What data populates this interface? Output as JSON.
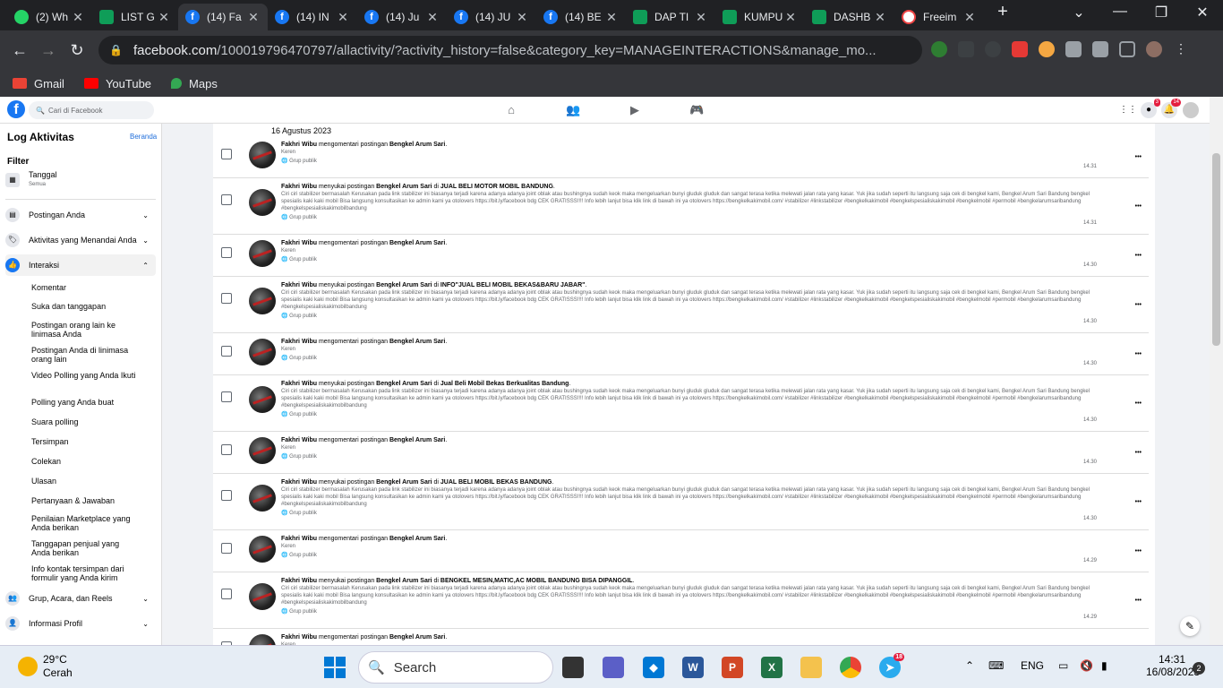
{
  "tabs": [
    {
      "label": "(2) Wh",
      "icon": "whatsapp-icon"
    },
    {
      "label": "LIST G",
      "icon": "sheets-icon"
    },
    {
      "label": "(14) Fa",
      "icon": "facebook-icon",
      "active": true
    },
    {
      "label": "(14) IN",
      "icon": "facebook-icon"
    },
    {
      "label": "(14) Ju",
      "icon": "facebook-icon"
    },
    {
      "label": "(14) JU",
      "icon": "facebook-icon"
    },
    {
      "label": "(14) BE",
      "icon": "facebook-icon"
    },
    {
      "label": "DAP TI",
      "icon": "sheets-icon"
    },
    {
      "label": "KUMPU",
      "icon": "sheets-icon"
    },
    {
      "label": "DASHB",
      "icon": "sheets-icon"
    },
    {
      "label": "Freeim",
      "icon": "freeimage-icon"
    }
  ],
  "browser": {
    "url_main": "facebook.com",
    "url_rest": "/100019796470797/allactivity/?activity_history=false&category_key=MANAGEINTERACTIONS&manage_mo..."
  },
  "bookmarks": [
    {
      "label": "Gmail",
      "color": "#ea4335"
    },
    {
      "label": "YouTube",
      "color": "#ff0000"
    },
    {
      "label": "Maps",
      "color": "#34a853"
    }
  ],
  "fb": {
    "search_placeholder": "Cari di Facebook",
    "badge_msg": "3",
    "badge_notif": "14"
  },
  "sidebar": {
    "title": "Log Aktivitas",
    "home": "Beranda",
    "filter": "Filter",
    "date_label": "Tanggal",
    "date_sub": "Semua",
    "sections": [
      {
        "label": "Postingan Anda"
      },
      {
        "label": "Aktivitas yang Menandai Anda"
      },
      {
        "label": "Interaksi"
      }
    ],
    "subitems": [
      "Komentar",
      "Suka dan tanggapan",
      "Postingan orang lain ke linimasa Anda",
      "Postingan Anda di linimasa orang lain",
      "Video Polling yang Anda Ikuti",
      "Polling yang Anda buat",
      "Suara polling",
      "Tersimpan",
      "Colekan",
      "Ulasan",
      "Pertanyaan & Jawaban",
      "Penilaian Marketplace yang Anda berikan",
      "Tanggapan penjual yang Anda berikan",
      "Info kontak tersimpan dari formulir yang Anda kirim"
    ],
    "more": [
      {
        "label": "Grup, Acara, dan Reels"
      },
      {
        "label": "Informasi Profil"
      }
    ]
  },
  "log": {
    "date": "16 Agustus 2023",
    "user": "Fakhri Wibu",
    "page": "Bengkel Arum Sari",
    "comment_verb": "mengomentari postingan",
    "like_verb": "menyukai postingan",
    "in_word": "di",
    "comment_text": "Keren",
    "privacy": "Grup publik",
    "long_text": "Ciri ciri stabilizer bermasalah Kerusakan pada link stabilizer ini biasanya terjadi karena adanya adanya joint oblak atau bushingnya sudah keok maka mengeluarkan bunyi gluduk gluduk dan sangat terasa ketika melewati jalan rata yang kasar. Yuk jika sudah seperti itu langsung saja cek di bengkel kami, Bengkel Arum Sari Bandung bengkel spesialis kaki kaki mobil Bisa langsung konsultasikan ke admin kami ya otolovers https://bit.ly/facebook bdg CEK GRATISSS!!!! Info lebih lanjut bisa klik link di bawah ini ya otolovers https://bengkelkakimobil.com/ #stabilizer #linkstabilizer #bengkelkakimobil #bengkelspesialiskakimobil #bengkelmobil #permobil #bengkelarumsaribandung #bengkelspesialiskakimobilbandung",
    "rows": [
      {
        "type": "comment",
        "time": "14.31"
      },
      {
        "type": "like",
        "group": "JUAL BELI MOTOR MOBIL BANDUNG",
        "time": "14.31"
      },
      {
        "type": "comment",
        "time": "14.30"
      },
      {
        "type": "like",
        "group": "INFO\"JUAL BELI MOBIL BEKAS&BARU JABAR\"",
        "time": "14.30"
      },
      {
        "type": "comment",
        "time": "14.30"
      },
      {
        "type": "like",
        "group": "Jual Beli Mobil Bekas Berkualitas Bandung",
        "time": "14.30"
      },
      {
        "type": "comment",
        "time": "14.30"
      },
      {
        "type": "like",
        "group": "JUAL BELI MOBIL BEKAS BANDUNG",
        "time": "14.30"
      },
      {
        "type": "comment",
        "time": "14.29"
      },
      {
        "type": "like",
        "group": "BENGKEL MESIN,MATIC,AC MOBIL BANDUNG BISA DIPANGGIL",
        "time": "14.29"
      },
      {
        "type": "comment",
        "time": ""
      }
    ]
  },
  "taskbar": {
    "temp": "29°C",
    "weather": "Cerah",
    "search": "Search",
    "lang": "ENG",
    "time": "14:31",
    "date": "16/08/2023",
    "notif_count": "2",
    "telegram_badge": "18"
  }
}
